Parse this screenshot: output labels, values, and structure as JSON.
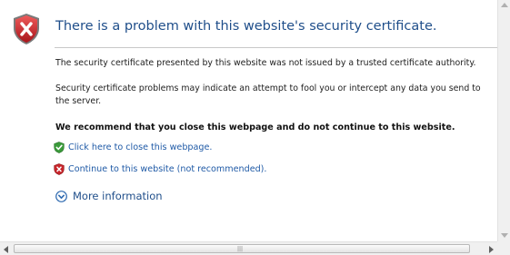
{
  "page": {
    "title": "There is a problem with this website's security certificate.",
    "paragraph1": "The security certificate presented by this website was not issued by a trusted certificate authority.",
    "paragraph2": "Security certificate problems may indicate an attempt to fool you or intercept any data you send to the server.",
    "recommendation": "We recommend that you close this webpage and do not continue to this website."
  },
  "links": {
    "close": {
      "label": "Click here to close this webpage.",
      "icon": "green-shield-check-icon"
    },
    "continue": {
      "label": "Continue to this website (not recommended).",
      "icon": "red-shield-x-icon"
    },
    "more_info": {
      "label": "More information",
      "icon": "expand-chevron-icon"
    }
  },
  "header_icon": "red-shield-x-icon",
  "scrollbar": {
    "grip": "|||"
  },
  "colors": {
    "title": "#1f4e8a",
    "link": "#1f5aa6",
    "shield_red": "#c8252b",
    "shield_green": "#3a9a3a"
  }
}
